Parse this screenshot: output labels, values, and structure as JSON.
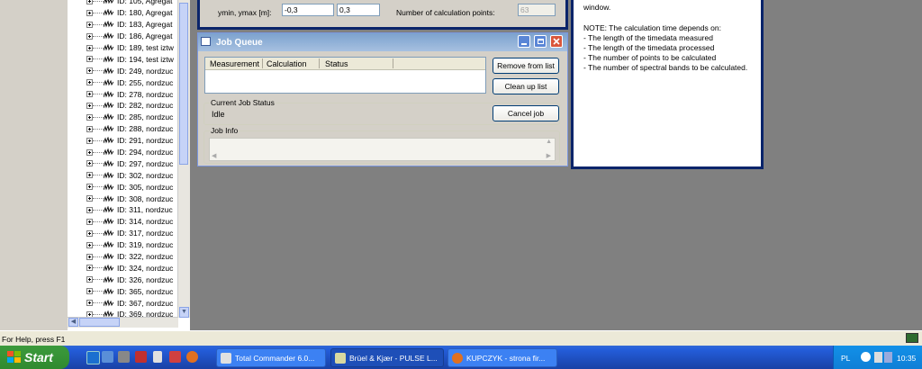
{
  "tree": {
    "items": [
      "ID: 105, Agregat",
      "ID: 180, Agregat",
      "ID: 183, Agregat",
      "ID: 186, Agregat",
      "ID: 189, test iztw",
      "ID: 194, test iztw",
      "ID: 249, nordzuc",
      "ID: 255, nordzuc",
      "ID: 278, nordzuc",
      "ID: 282, nordzuc",
      "ID: 285, nordzuc",
      "ID: 288, nordzuc",
      "ID: 291, nordzuc",
      "ID: 294, nordzuc",
      "ID: 297, nordzuc",
      "ID: 302, nordzuc",
      "ID: 305, nordzuc",
      "ID: 308, nordzuc",
      "ID: 311, nordzuc",
      "ID: 314, nordzuc",
      "ID: 317, nordzuc",
      "ID: 319, nordzuc",
      "ID: 322, nordzuc",
      "ID: 324, nordzuc",
      "ID: 326, nordzuc",
      "ID: 365, nordzuc",
      "ID: 367, nordzuc",
      "ID: 369, nordzuc"
    ]
  },
  "calc_dialog": {
    "ymin_ymax_label": "ymin, ymax [m]:",
    "ymin_value": "-0,3",
    "ymax_value": "0,3",
    "points_label": "Number of calculation points:",
    "points_value": "63"
  },
  "note": {
    "line0": "window.",
    "line1": "NOTE: The calculation time depends on:",
    "line2": "- The length of the timedata measured",
    "line3": "- The length of the timedata processed",
    "line4": "- The number of points to be calculated",
    "line5": "- The number of spectral bands to be calculated."
  },
  "job_queue": {
    "title": "Job Queue",
    "columns": [
      "Measurement",
      "Calculation",
      "Status"
    ],
    "remove_button": "Remove from list",
    "cleanup_button": "Clean up list",
    "current_status_label": "Current Job Status",
    "current_status_value": "Idle",
    "cancel_button": "Cancel job",
    "job_info_label": "Job Info"
  },
  "statusbar": {
    "help_text": "For Help, press F1"
  },
  "taskbar": {
    "start_label": "Start",
    "tasks": [
      "Total Commander 6.0...",
      "Brüel & Kjær - PULSE L...",
      "KUPCZYK - strona fir..."
    ],
    "language": "PL",
    "clock": "10:35"
  },
  "colors": {
    "title_bar": "#7da2ce",
    "taskbar": "#245edb",
    "start": "#3c9a3c",
    "tray": "#0f7fd6"
  }
}
